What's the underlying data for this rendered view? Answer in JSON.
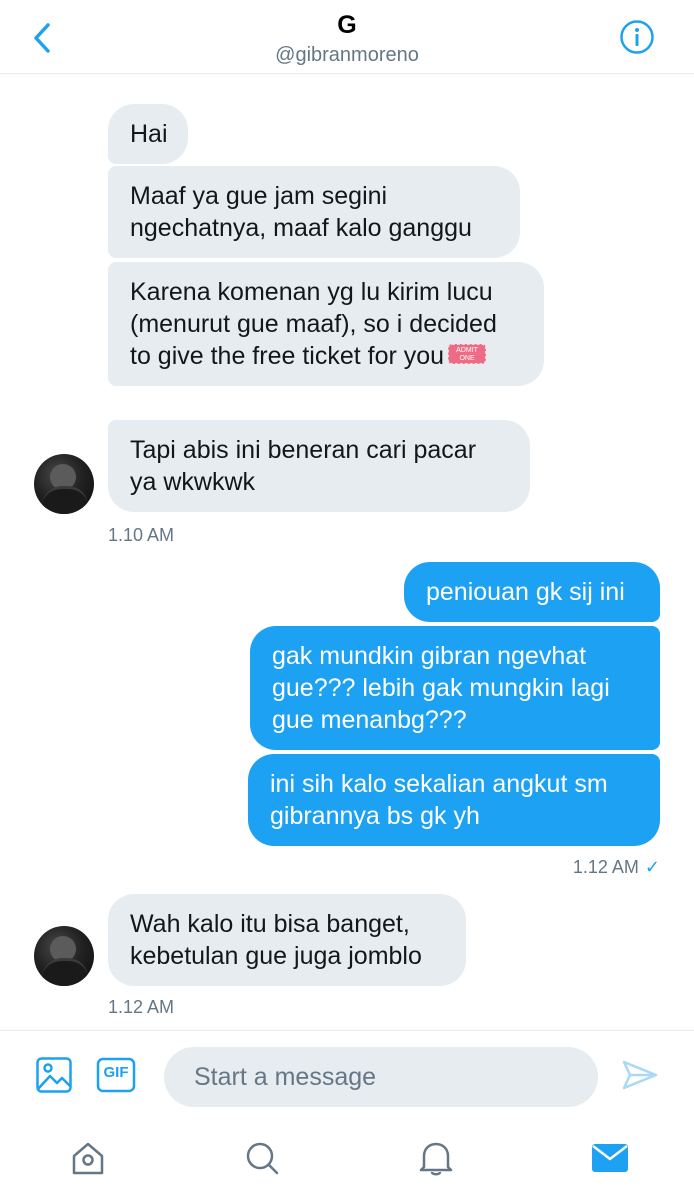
{
  "header": {
    "title": "G",
    "handle": "@gibranmoreno"
  },
  "messages": [
    {
      "text": "Hai"
    },
    {
      "text": "Maaf ya gue jam segini ngechatnya, maaf kalo ganggu"
    },
    {
      "text": "Karena komenan yg lu kirim lucu (menurut gue maaf), so i decided to give the free ticket for you",
      "emoji": "admit-one-ticket-emoji",
      "emoji_text": "ADMIT ONE"
    },
    {
      "text": "Tapi abis ini beneran cari pacar ya wkwkwk"
    },
    {
      "text": "peniouan gk sij ini"
    },
    {
      "text": "gak mundkin gibran ngevhat gue??? lebih gak mungkin lagi gue menanbg???"
    },
    {
      "text": "ini sih kalo sekalian angkut sm gibrannya bs gk yh"
    },
    {
      "text": "Wah kalo itu bisa banget, kebetulan gue juga jomblo"
    }
  ],
  "timestamps": {
    "group1": "1.10 AM",
    "group2": "1.12 AM",
    "group2_read_mark": "✓",
    "group3": "1.12 AM"
  },
  "composer": {
    "placeholder": "Start a message",
    "gif_label": "GIF"
  },
  "icons": {
    "back": "chevron-left-icon",
    "info": "info-icon",
    "image": "image-icon",
    "gif": "gif-icon",
    "send": "send-icon",
    "home": "home-icon",
    "search": "search-icon",
    "notifications": "bell-icon",
    "messages": "mail-icon"
  },
  "colors": {
    "accent": "#1da1f2",
    "incoming_bubble": "#e6ecf0",
    "secondary_text": "#657786"
  }
}
